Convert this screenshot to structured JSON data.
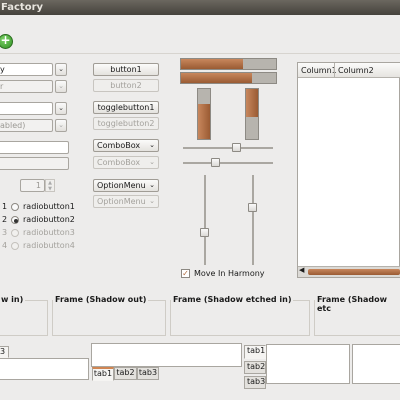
{
  "window": {
    "title": "Factory"
  },
  "toolbar": {
    "add_label": "+"
  },
  "col1": {
    "combo1": "y",
    "combo2": "r",
    "combo3": "",
    "combo4": "abled)",
    "entry1": "",
    "entry2": "",
    "spin_value": "1",
    "radio_numbers": [
      "1",
      "2",
      "3",
      "4"
    ],
    "radio_labels": [
      "radiobutton1",
      "radiobutton2",
      "radiobutton3",
      "radiobutton4"
    ]
  },
  "col2": {
    "button1": "button1",
    "button2": "button2",
    "toggle1": "togglebutton1",
    "toggle2": "togglebutton2",
    "combo1": "ComboBox",
    "combo2": "ComboBox",
    "option1": "OptionMenu",
    "option2": "OptionMenu"
  },
  "col3": {
    "progress_h1": 0.65,
    "progress_h2": 0.75,
    "progress_v1": 0.7,
    "progress_v2": 0.55,
    "scale_h1": 0.6,
    "scale_h2": 0.35,
    "scale_v1": 0.65,
    "scale_v2": 0.35,
    "checkbox_label": "Move In Harmony",
    "checkbox_checked": true
  },
  "tree": {
    "columns": [
      "Column1",
      "Column2"
    ]
  },
  "frames": {
    "shadow_in": "w in)",
    "shadow_out": "Frame (Shadow out)",
    "shadow_etched_in": "Frame (Shadow etched in)",
    "shadow_etched_out": "Frame (Shadow etc"
  },
  "notebooks": {
    "nb1_tab": "3",
    "nb2_tabs": [
      "tab1",
      "tab2",
      "tab3"
    ],
    "nb3_tabs": [
      "tab1",
      "tab2",
      "tab3"
    ]
  },
  "colors": {
    "accent": "#b06a3e",
    "titlebar": "#4a4740"
  }
}
